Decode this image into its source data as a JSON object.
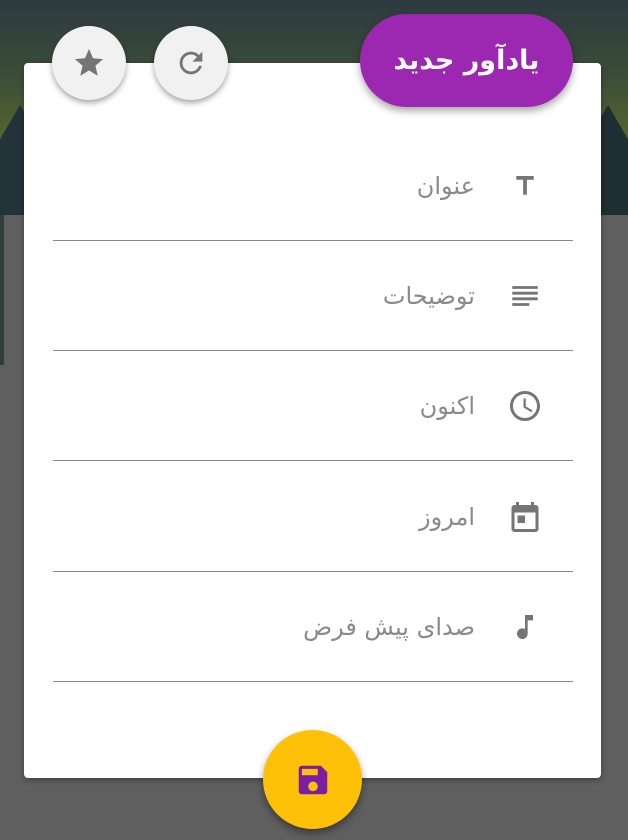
{
  "header": {
    "title": "یادآور جدید"
  },
  "toolbar": {
    "favorite_icon": "star-icon",
    "reset_icon": "refresh-icon"
  },
  "form": {
    "fields": [
      {
        "icon": "text-format-icon",
        "placeholder": "عنوان"
      },
      {
        "icon": "description-lines-icon",
        "placeholder": "توضیحات"
      },
      {
        "icon": "clock-icon",
        "value": "اکنون"
      },
      {
        "icon": "calendar-icon",
        "value": "امروز"
      },
      {
        "icon": "music-note-icon",
        "value": "صدای پیش فرض"
      }
    ]
  },
  "actions": {
    "save_icon": "save-floppy-icon"
  },
  "colors": {
    "accent": "#9c27b0",
    "fab": "#ffc107",
    "icon": "#757575",
    "text_muted": "#8a8a8a",
    "scrim": "#5f5f5f"
  }
}
